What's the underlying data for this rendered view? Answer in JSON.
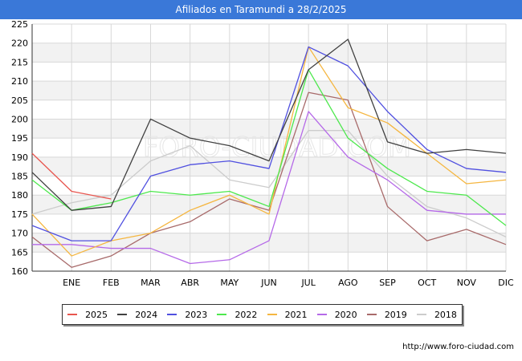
{
  "header": {
    "title": "Afiliados en Taramundi a 28/2/2025"
  },
  "source": "http://www.foro-ciudad.com",
  "watermark": "FORO-CIUDAD.COM",
  "chart_data": {
    "type": "line",
    "title": "Afiliados en Taramundi a 28/2/2025",
    "categories": [
      "",
      "ENE",
      "FEB",
      "MAR",
      "ABR",
      "MAY",
      "JUN",
      "JUL",
      "AGO",
      "SEP",
      "OCT",
      "NOV",
      "DIC"
    ],
    "ylim": [
      160,
      225
    ],
    "yticks": [
      160,
      165,
      170,
      175,
      180,
      185,
      190,
      195,
      200,
      205,
      210,
      215,
      220,
      225
    ],
    "grid": true,
    "legend_position": "bottom",
    "series": [
      {
        "name": "2025",
        "color": "#e8554e",
        "values": [
          191,
          181,
          179
        ]
      },
      {
        "name": "2024",
        "color": "#404040",
        "values": [
          186,
          176,
          177,
          200,
          195,
          193,
          189,
          213,
          221,
          194,
          191,
          192,
          191
        ]
      },
      {
        "name": "2023",
        "color": "#5050e0",
        "values": [
          172,
          168,
          168,
          185,
          188,
          189,
          187,
          219,
          214,
          202,
          192,
          187,
          186
        ]
      },
      {
        "name": "2022",
        "color": "#4de84d",
        "values": [
          184,
          176,
          178,
          181,
          180,
          181,
          177,
          213,
          195,
          187,
          181,
          180,
          172
        ]
      },
      {
        "name": "2021",
        "color": "#f5b640",
        "values": [
          175,
          164,
          168,
          170,
          176,
          180,
          175,
          219,
          203,
          199,
          191,
          183,
          184
        ]
      },
      {
        "name": "2020",
        "color": "#b569e8",
        "values": [
          167,
          167,
          166,
          166,
          162,
          163,
          168,
          202,
          190,
          184,
          176,
          175,
          175
        ]
      },
      {
        "name": "2019",
        "color": "#a86a6a",
        "values": [
          169,
          161,
          164,
          170,
          173,
          179,
          176,
          207,
          205,
          177,
          168,
          171,
          167
        ]
      },
      {
        "name": "2018",
        "color": "#cccccc",
        "values": [
          175,
          178,
          180,
          189,
          193,
          184,
          182,
          197,
          197,
          185,
          177,
          174,
          169
        ]
      }
    ]
  }
}
